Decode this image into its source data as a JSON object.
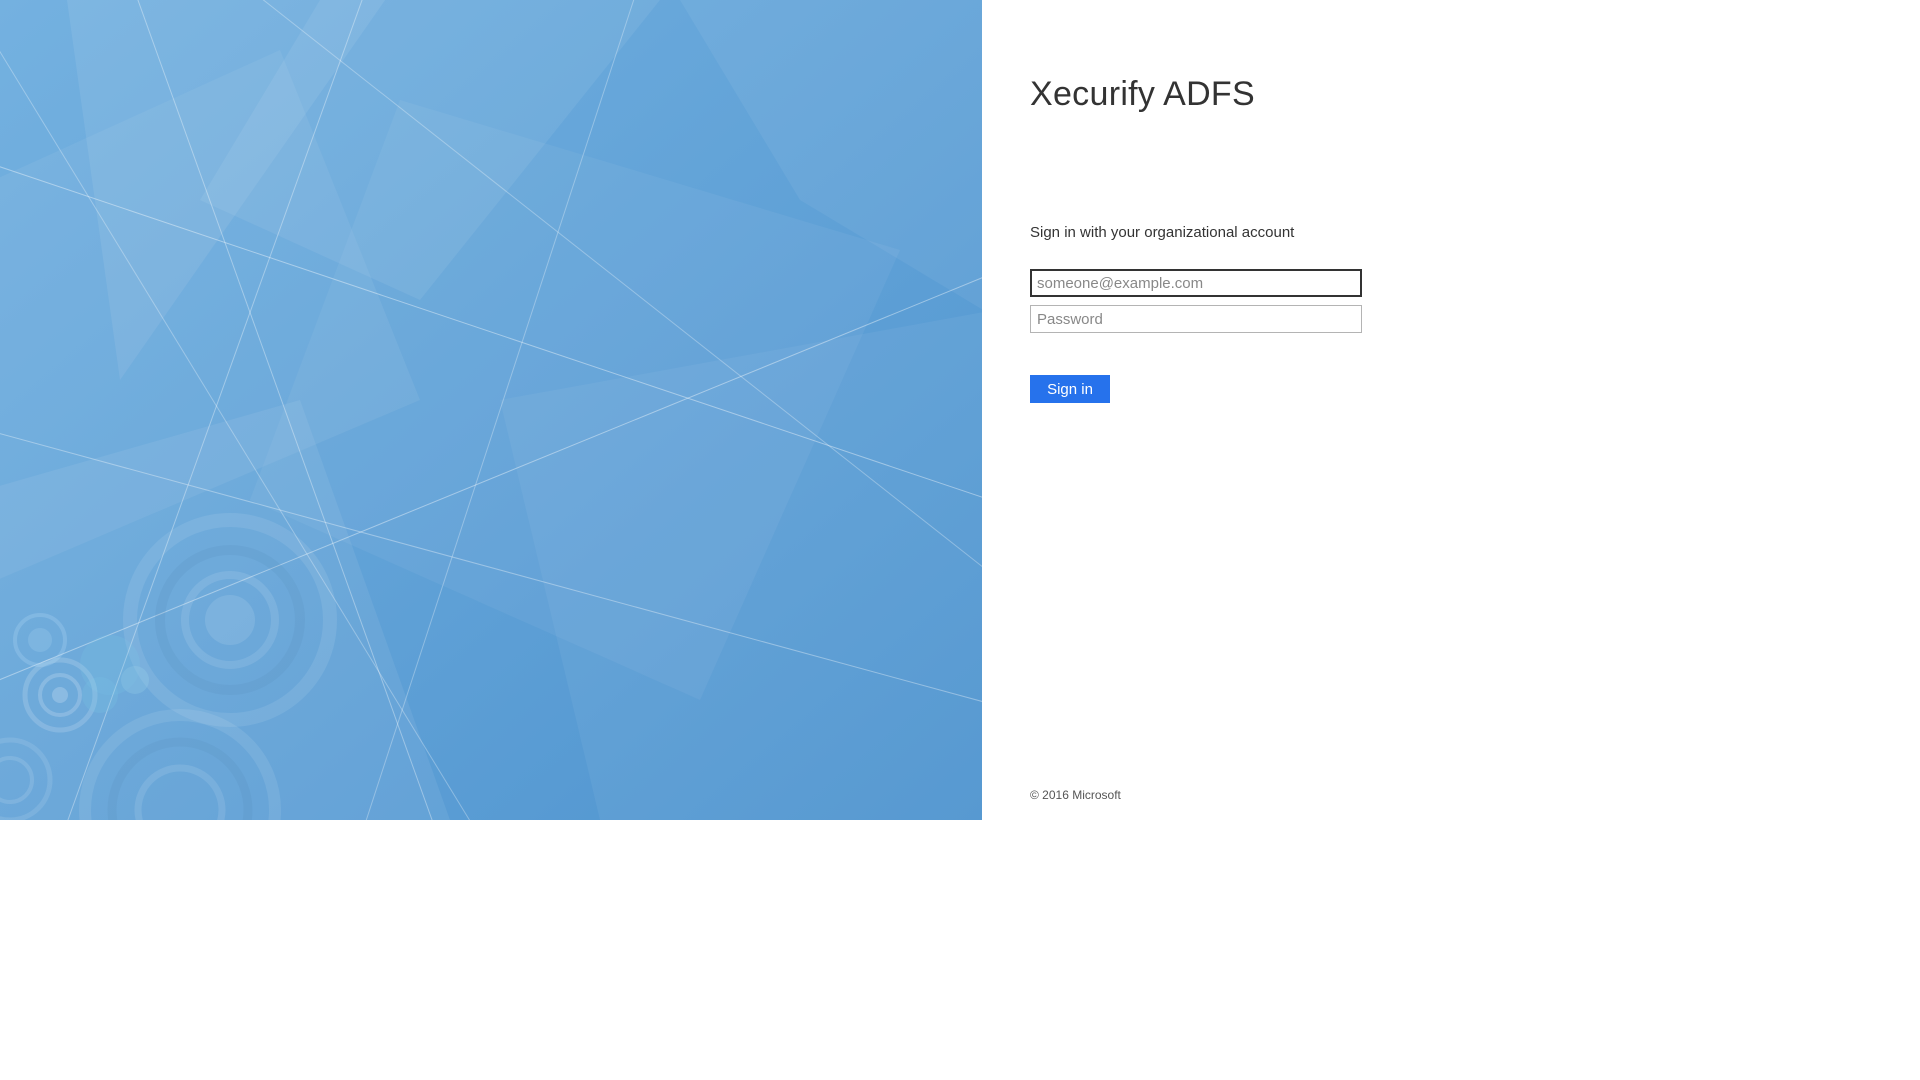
{
  "header": {
    "title": "Xecurify ADFS"
  },
  "form": {
    "instruction": "Sign in with your organizational account",
    "username_placeholder": "someone@example.com",
    "username_value": "",
    "password_placeholder": "Password",
    "password_value": "",
    "signin_label": "Sign in"
  },
  "footer": {
    "copyright": "© 2016 Microsoft"
  },
  "colors": {
    "accent": "#2672ec",
    "bg_left": "#5a9fd4"
  }
}
